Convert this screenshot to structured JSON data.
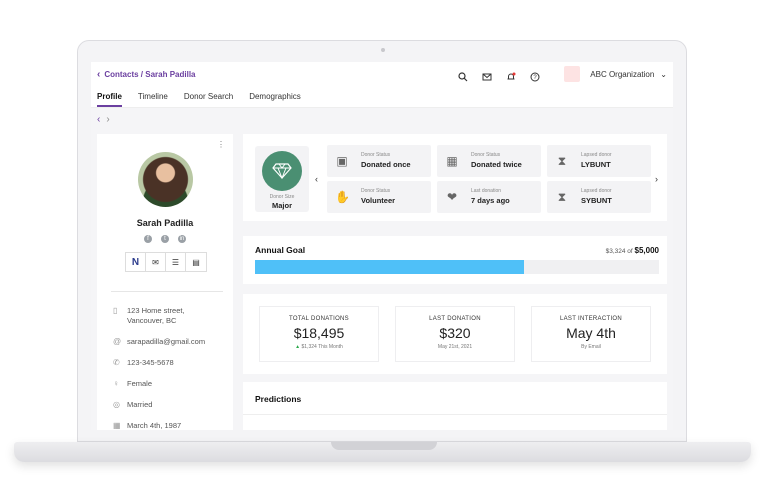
{
  "breadcrumb": "Contacts / Sarah Padilla",
  "org": {
    "name": "ABC Organization"
  },
  "tabs": [
    {
      "label": "Profile",
      "active": true
    },
    {
      "label": "Timeline",
      "active": false
    },
    {
      "label": "Donor Search",
      "active": false
    },
    {
      "label": "Demographics",
      "active": false
    }
  ],
  "profile": {
    "name": "Sarah Padilla",
    "address_line1": "123 Home street,",
    "address_line2": "Vancouver, BC",
    "email": "sarapadilla@gmail.com",
    "phone": "123-345-5678",
    "gender": "Female",
    "marital": "Married",
    "birthday": "March 4th, 1987"
  },
  "donor_size": {
    "label": "Donor Size",
    "value": "Major"
  },
  "status_tiles": [
    {
      "label": "Donor Status",
      "value": "Donated once",
      "icon": "gift-icon"
    },
    {
      "label": "Donor Status",
      "value": "Donated twice",
      "icon": "gifts-icon"
    },
    {
      "label": "Lapsed donor",
      "value": "LYBUNT",
      "icon": "hourglass-icon"
    },
    {
      "label": "Donor Status",
      "value": "Volunteer",
      "icon": "handshake-icon"
    },
    {
      "label": "Last donation",
      "value": "7 days ago",
      "icon": "hand-heart-icon"
    },
    {
      "label": "Lapsed donor",
      "value": "SYBUNT",
      "icon": "hourglass-icon"
    }
  ],
  "goal": {
    "title": "Annual Goal",
    "current": "$3,324",
    "of": "of",
    "target": "$5,000",
    "progress": 0.665
  },
  "stats": [
    {
      "label": "TOTAL DONATIONS",
      "value": "$18,495",
      "sub_arrow": "▲",
      "sub": "$1,324 This Month"
    },
    {
      "label": "LAST DONATION",
      "value": "$320",
      "sub": "May 21st, 2021"
    },
    {
      "label": "LAST INTERACTION",
      "value": "May 4th",
      "sub": "By Email"
    }
  ],
  "predictions": {
    "title": "Predictions"
  },
  "colors": {
    "accent": "#6b3fa0",
    "progress": "#4fc0f8",
    "donor_badge": "#4a8f72",
    "up": "#2aa84a"
  }
}
